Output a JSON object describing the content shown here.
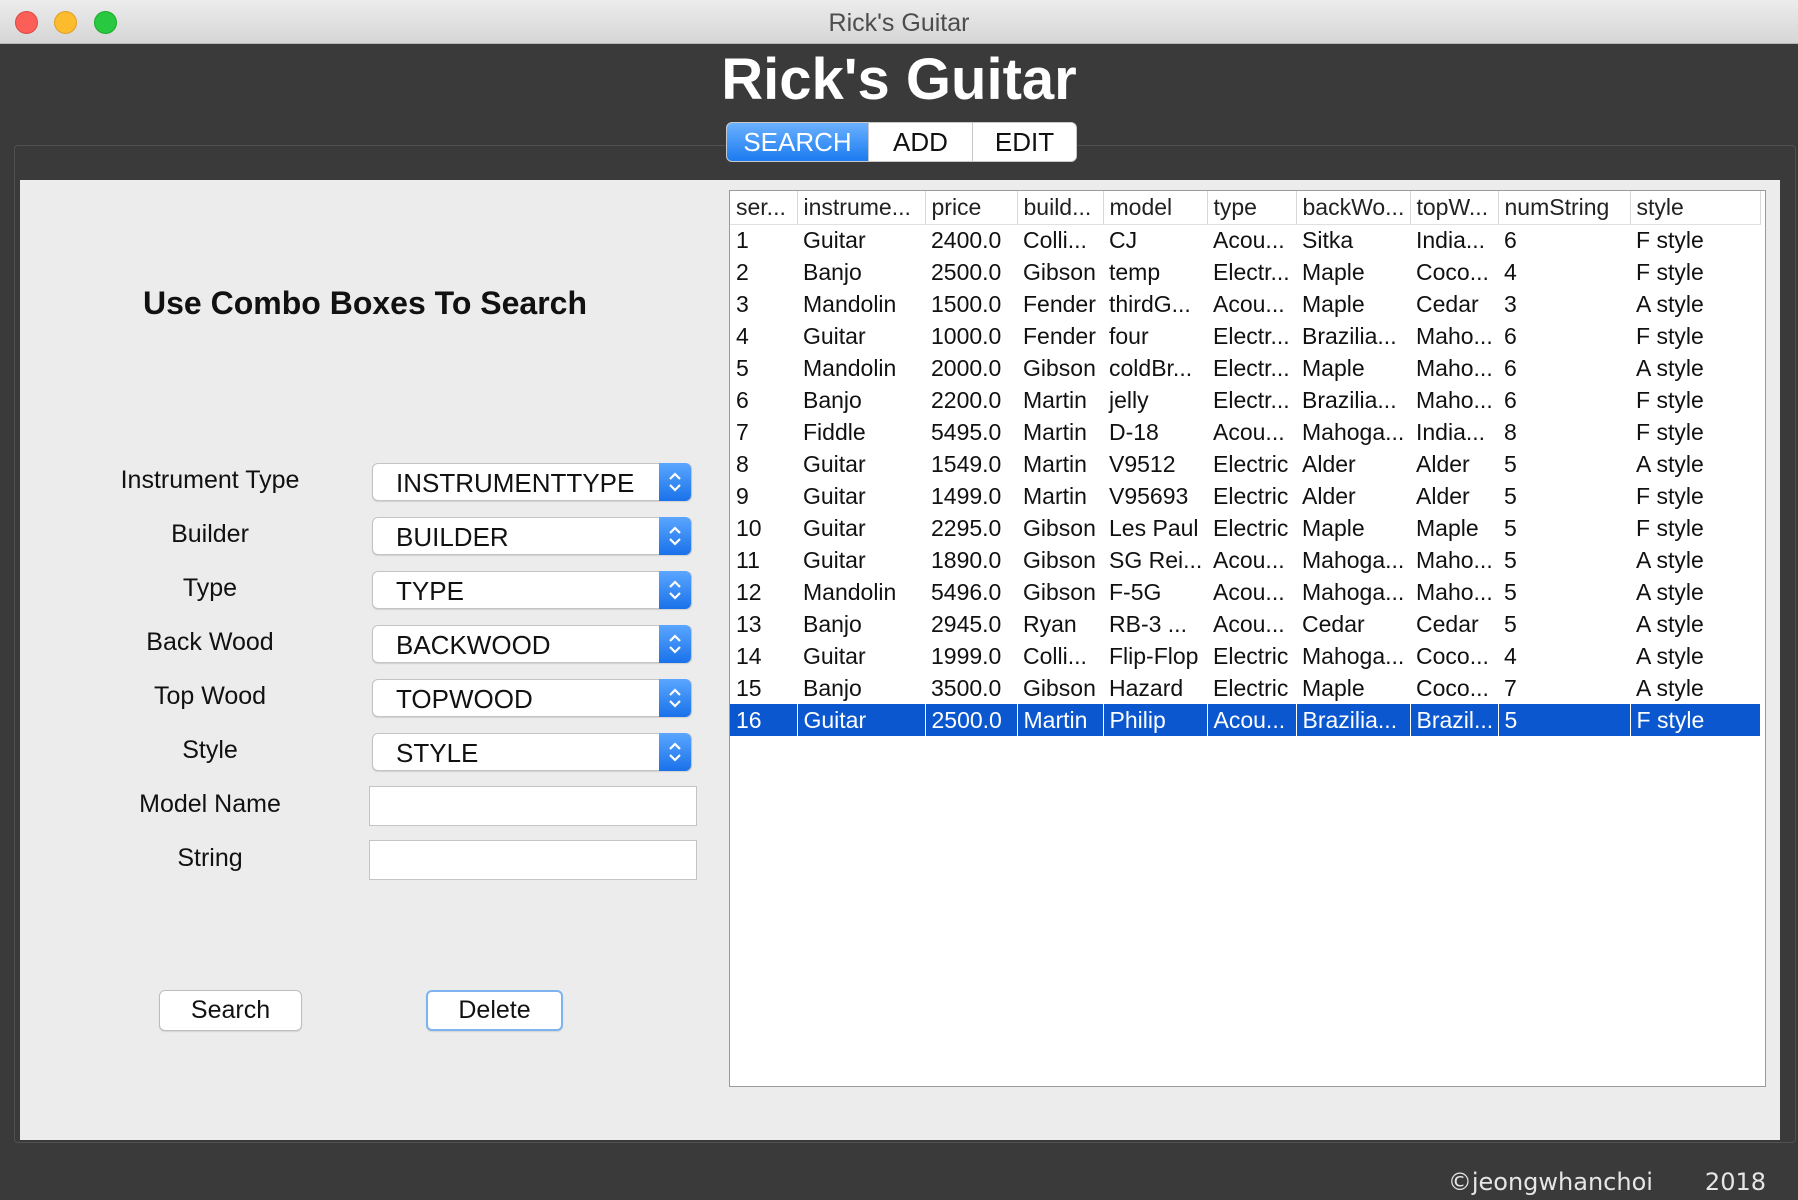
{
  "window": {
    "title": "Rick's Guitar"
  },
  "app": {
    "title": "Rick's Guitar"
  },
  "tabs": [
    {
      "label": "SEARCH",
      "active": true
    },
    {
      "label": "ADD",
      "active": false
    },
    {
      "label": "EDIT",
      "active": false
    }
  ],
  "search_panel": {
    "heading": "Use Combo Boxes To Search",
    "fields": {
      "instrument_type": {
        "label": "Instrument Type",
        "value": "INSTRUMENTTYPE"
      },
      "builder": {
        "label": "Builder",
        "value": "BUILDER"
      },
      "type": {
        "label": "Type",
        "value": "TYPE"
      },
      "back_wood": {
        "label": "Back Wood",
        "value": "BACKWOOD"
      },
      "top_wood": {
        "label": "Top Wood",
        "value": "TOPWOOD"
      },
      "style": {
        "label": "Style",
        "value": "STYLE"
      },
      "model_name": {
        "label": "Model Name",
        "value": ""
      },
      "string": {
        "label": "String",
        "value": ""
      }
    },
    "buttons": {
      "search": "Search",
      "delete": "Delete"
    }
  },
  "table": {
    "columns": [
      "ser...",
      "instrume...",
      "price",
      "build...",
      "model",
      "type",
      "backWo...",
      "topW...",
      "numString",
      "style"
    ],
    "selected_row": 15,
    "rows": [
      [
        "1",
        "Guitar",
        "2400.0",
        "Colli...",
        "CJ",
        "Acou...",
        "Sitka",
        "India...",
        "6",
        "F style"
      ],
      [
        "2",
        "Banjo",
        "2500.0",
        "Gibson",
        "temp",
        "Electr...",
        "Maple",
        "Coco...",
        "4",
        "F style"
      ],
      [
        "3",
        "Mandolin",
        "1500.0",
        "Fender",
        "thirdG...",
        "Acou...",
        "Maple",
        "Cedar",
        "3",
        "A style"
      ],
      [
        "4",
        "Guitar",
        "1000.0",
        "Fender",
        "four",
        "Electr...",
        "Brazilia...",
        "Maho...",
        "6",
        "F style"
      ],
      [
        "5",
        "Mandolin",
        "2000.0",
        "Gibson",
        "coldBr...",
        "Electr...",
        "Maple",
        "Maho...",
        "6",
        "A style"
      ],
      [
        "6",
        "Banjo",
        "2200.0",
        "Martin",
        "jelly",
        "Electr...",
        "Brazilia...",
        "Maho...",
        "6",
        "F style"
      ],
      [
        "7",
        "Fiddle",
        "5495.0",
        "Martin",
        "D-18",
        "Acou...",
        "Mahoga...",
        "India...",
        "8",
        "F style"
      ],
      [
        "8",
        "Guitar",
        "1549.0",
        "Martin",
        "V9512",
        "Electric",
        "Alder",
        "Alder",
        "5",
        "A style"
      ],
      [
        "9",
        "Guitar",
        "1499.0",
        "Martin",
        "V95693",
        "Electric",
        "Alder",
        "Alder",
        "5",
        "F style"
      ],
      [
        "10",
        "Guitar",
        "2295.0",
        "Gibson",
        "Les Paul",
        "Electric",
        "Maple",
        "Maple",
        "5",
        "F style"
      ],
      [
        "11",
        "Guitar",
        "1890.0",
        "Gibson",
        "SG Rei...",
        "Acou...",
        "Mahoga...",
        "Maho...",
        "5",
        "A style"
      ],
      [
        "12",
        "Mandolin",
        "5496.0",
        "Gibson",
        "F-5G",
        "Acou...",
        "Mahoga...",
        "Maho...",
        "5",
        "A style"
      ],
      [
        "13",
        "Banjo",
        "2945.0",
        "Ryan",
        "RB-3 ...",
        "Acou...",
        "Cedar",
        "Cedar",
        "5",
        "A style"
      ],
      [
        "14",
        "Guitar",
        "1999.0",
        "Colli...",
        "Flip-Flop",
        "Electric",
        "Mahoga...",
        "Coco...",
        "4",
        "A style"
      ],
      [
        "15",
        "Banjo",
        "3500.0",
        "Gibson",
        "Hazard",
        "Electric",
        "Maple",
        "Coco...",
        "7",
        "A style"
      ],
      [
        "16",
        "Guitar",
        "2500.0",
        "Martin",
        "Philip",
        "Acou...",
        "Brazilia...",
        "Brazil...",
        "5",
        "F style"
      ]
    ]
  },
  "footer": {
    "author": "©jeongwhanchoi",
    "year": "2018"
  },
  "colors": {
    "accent": "#1b7bf0",
    "selection": "#0b57d0",
    "window_bg": "#3a3a3a",
    "panel_bg": "#ececec"
  }
}
